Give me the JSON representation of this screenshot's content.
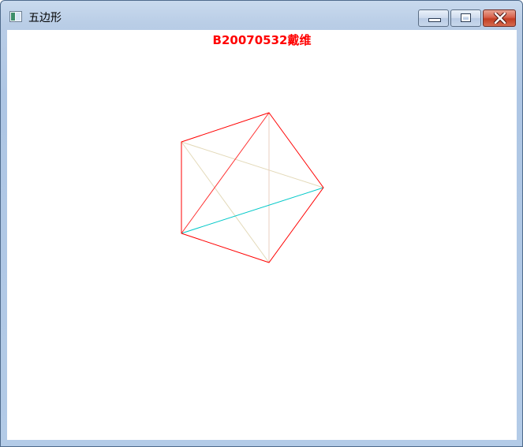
{
  "window": {
    "title": "五边形",
    "controls": {
      "minimize_icon": "minimize-icon",
      "maximize_icon": "maximize-icon",
      "close_icon": "close-icon"
    }
  },
  "canvas": {
    "caption": "B20070532戴维",
    "caption_color": "#ff0000",
    "outline_color": "#ff0000",
    "diagonal_colors": {
      "tan": "#e3d9b8",
      "cyan": "#00c8c8",
      "red": "#ff0000"
    }
  }
}
